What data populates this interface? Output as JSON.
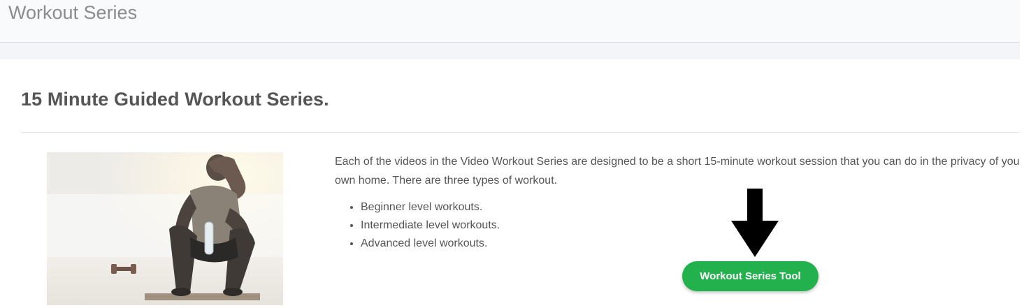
{
  "header": {
    "title": "Workout Series"
  },
  "section": {
    "title": "15 Minute Guided Workout Series.",
    "description": "Each of the videos in the Video Workout Series are designed to be a short 15-minute workout session that you can do in the privacy of your own home. There are three types of workout.",
    "levels": [
      "Beginner level workouts.",
      "Intermediate level workouts.",
      "Advanced level workouts."
    ]
  },
  "image": {
    "subject": "man-resting-with-water-bottle"
  },
  "annotation": {
    "icon": "arrow-down-icon",
    "color": "#000000"
  },
  "tool_button": {
    "label": "Workout Series Tool",
    "color": "#22b14c"
  }
}
